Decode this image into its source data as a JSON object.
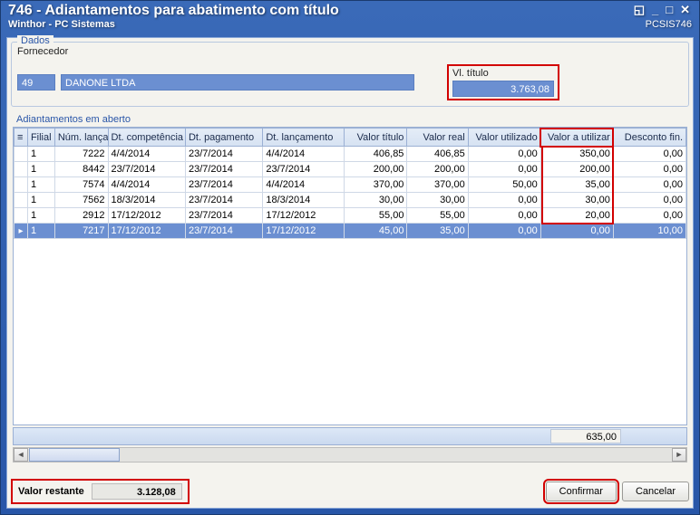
{
  "window": {
    "title": "746 - Adiantamentos para abatimento com título",
    "subtitle": "Winthor - PC Sistemas",
    "code": "PCSIS746"
  },
  "dados": {
    "group_label": "Dados",
    "fornecedor_label": "Fornecedor",
    "fornecedor_code": "49",
    "fornecedor_name": "DANONE LTDA",
    "vl_titulo_label": "Vl. título",
    "vl_titulo_value": "3.763,08"
  },
  "adiant": {
    "section_label": "Adiantamentos em aberto",
    "columns": {
      "filial": "Filial",
      "num": "Núm. lança",
      "comp": "Dt. competência",
      "pag": "Dt. pagamento",
      "lanc": "Dt. lançamento",
      "vtit": "Valor título",
      "vreal": "Valor real",
      "vutil": "Valor utilizado",
      "vautil": "Valor a utilizar",
      "desc": "Desconto fin."
    },
    "rows": [
      {
        "filial": "1",
        "num": "7222",
        "comp": "4/4/2014",
        "pag": "23/7/2014",
        "lanc": "4/4/2014",
        "vtit": "406,85",
        "vreal": "406,85",
        "vutil": "0,00",
        "vautil": "350,00",
        "desc": "0,00"
      },
      {
        "filial": "1",
        "num": "8442",
        "comp": "23/7/2014",
        "pag": "23/7/2014",
        "lanc": "23/7/2014",
        "vtit": "200,00",
        "vreal": "200,00",
        "vutil": "0,00",
        "vautil": "200,00",
        "desc": "0,00"
      },
      {
        "filial": "1",
        "num": "7574",
        "comp": "4/4/2014",
        "pag": "23/7/2014",
        "lanc": "4/4/2014",
        "vtit": "370,00",
        "vreal": "370,00",
        "vutil": "50,00",
        "vautil": "35,00",
        "desc": "0,00"
      },
      {
        "filial": "1",
        "num": "7562",
        "comp": "18/3/2014",
        "pag": "23/7/2014",
        "lanc": "18/3/2014",
        "vtit": "30,00",
        "vreal": "30,00",
        "vutil": "0,00",
        "vautil": "30,00",
        "desc": "0,00"
      },
      {
        "filial": "1",
        "num": "2912",
        "comp": "17/12/2012",
        "pag": "23/7/2014",
        "lanc": "17/12/2012",
        "vtit": "55,00",
        "vreal": "55,00",
        "vutil": "0,00",
        "vautil": "20,00",
        "desc": "0,00"
      },
      {
        "filial": "1",
        "num": "7217",
        "comp": "17/12/2012",
        "pag": "23/7/2014",
        "lanc": "17/12/2012",
        "vtit": "45,00",
        "vreal": "35,00",
        "vutil": "0,00",
        "vautil": "0,00",
        "desc": "10,00"
      }
    ],
    "sum_vautil": "635,00"
  },
  "footer": {
    "valor_restante_label": "Valor restante",
    "valor_restante_value": "3.128,08",
    "confirmar": "Confirmar",
    "cancelar": "Cancelar"
  }
}
